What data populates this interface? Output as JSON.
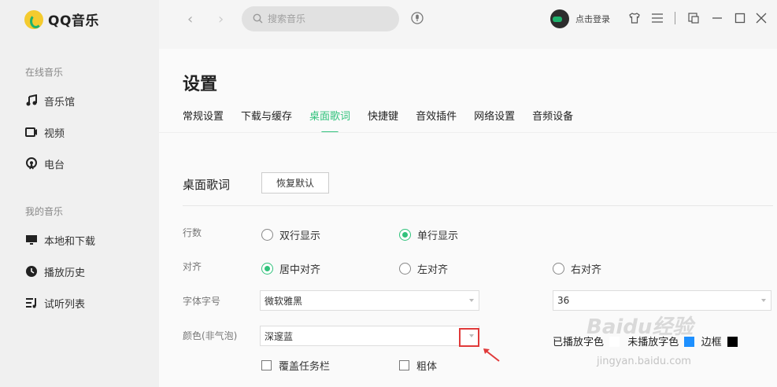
{
  "app": {
    "name": "QQ音乐"
  },
  "sidebar": {
    "online_title": "在线音乐",
    "online_items": [
      {
        "label": "音乐馆",
        "icon": "music-note-icon"
      },
      {
        "label": "视频",
        "icon": "video-icon"
      },
      {
        "label": "电台",
        "icon": "radio-icon"
      }
    ],
    "mine_title": "我的音乐",
    "mine_items": [
      {
        "label": "本地和下载",
        "icon": "monitor-icon"
      },
      {
        "label": "播放历史",
        "icon": "clock-icon"
      },
      {
        "label": "试听列表",
        "icon": "playlist-icon"
      }
    ]
  },
  "topbar": {
    "search_placeholder": "搜索音乐",
    "login_label": "点击登录"
  },
  "page": {
    "title": "设置",
    "tabs": [
      "常规设置",
      "下载与缓存",
      "桌面歌词",
      "快捷键",
      "音效插件",
      "网络设置",
      "音频设备"
    ],
    "active_tab": "桌面歌词"
  },
  "desktop_lyrics": {
    "section_title": "桌面歌词",
    "reset_button": "恢复默认",
    "lines_label": "行数",
    "lines_options": [
      "双行显示",
      "单行显示"
    ],
    "lines_selected": "单行显示",
    "align_label": "对齐",
    "align_options": [
      "居中对齐",
      "左对齐",
      "右对齐"
    ],
    "align_selected": "居中对齐",
    "font_label": "字体字号",
    "font_value": "微软雅黑",
    "size_value": "36",
    "color_label": "颜色(非气泡)",
    "color_value": "深邃蓝",
    "color_played_label": "已播放字色",
    "color_unplayed_label": "未播放字色",
    "border_label": "边框",
    "taskbar_label": "覆盖任务栏",
    "bold_label": "粗体"
  },
  "colors": {
    "accent": "#31c27c",
    "highlight": "#e03a3a"
  },
  "watermark": {
    "main": "Baidu经验",
    "sub": "jingyan.baidu.com"
  }
}
